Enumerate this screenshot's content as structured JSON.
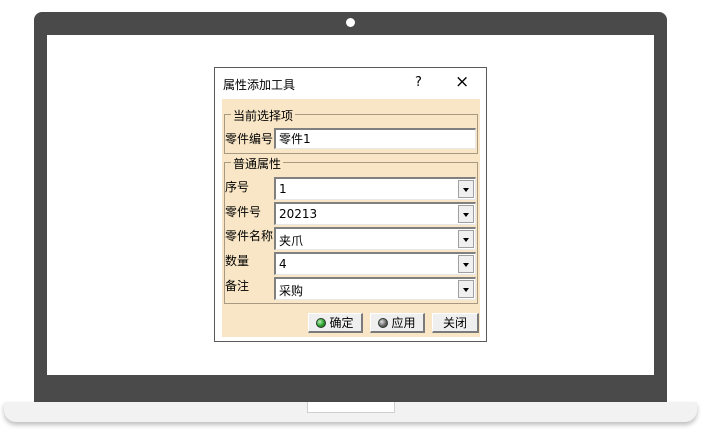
{
  "dialog": {
    "title": "属性添加工具",
    "help_label": "?",
    "close_label": "×"
  },
  "current_selection": {
    "group_label": "当前选择项",
    "part_number_label": "零件编号",
    "part_number_value": "零件1"
  },
  "common_properties": {
    "group_label": "普通属性",
    "fields": [
      {
        "label": "序号",
        "value": "1"
      },
      {
        "label": "零件号",
        "value": "20213"
      },
      {
        "label": "零件名称",
        "value": "夹爪"
      },
      {
        "label": "数量",
        "value": "4"
      },
      {
        "label": "备注",
        "value": "采购"
      }
    ]
  },
  "buttons": {
    "ok": "确定",
    "apply": "应用",
    "close": "关闭"
  },
  "colors": {
    "dialog_background": "#f8e6c6",
    "laptop_frame": "#4a4a4a"
  }
}
